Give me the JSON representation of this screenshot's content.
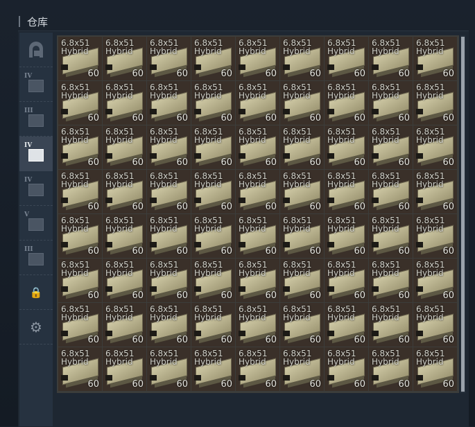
{
  "header": {
    "title": "仓库"
  },
  "sidebar": {
    "items": [
      {
        "name": "all-items",
        "tier": "",
        "active": false
      },
      {
        "name": "category-iv-a",
        "tier": "IV",
        "active": false
      },
      {
        "name": "category-iii-a",
        "tier": "III",
        "active": false
      },
      {
        "name": "category-iv-b",
        "tier": "IV",
        "active": true
      },
      {
        "name": "category-iv-c",
        "tier": "IV",
        "active": false
      },
      {
        "name": "category-v",
        "tier": "V",
        "active": false
      },
      {
        "name": "category-iii-b",
        "tier": "III",
        "active": false
      },
      {
        "name": "lock",
        "tier": "",
        "active": false
      },
      {
        "name": "settings",
        "tier": "",
        "active": false
      }
    ]
  },
  "grid": {
    "columns": 9,
    "rows": 8,
    "item": {
      "line1": "6.8x51",
      "line2": "Hybrid",
      "qty": "60"
    },
    "item_count": 72
  },
  "scrollbar": {
    "position": 0
  }
}
